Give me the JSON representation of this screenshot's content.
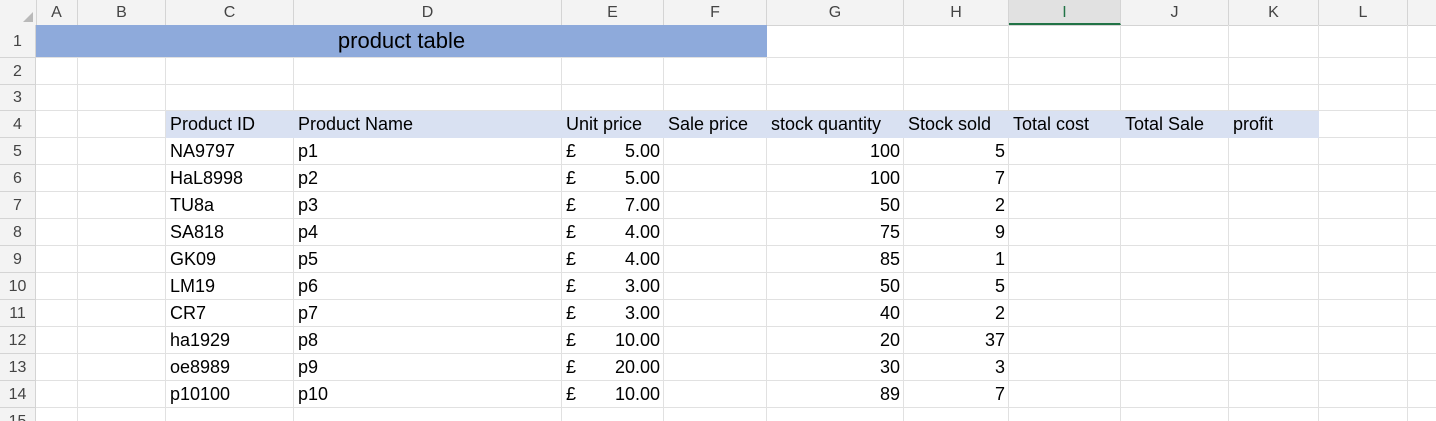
{
  "sheet": {
    "columns": [
      "A",
      "B",
      "C",
      "D",
      "E",
      "F",
      "G",
      "H",
      "I",
      "J",
      "K",
      "L"
    ],
    "selected_column": "I",
    "rows": [
      "1",
      "2",
      "3",
      "4",
      "5",
      "6",
      "7",
      "8",
      "9",
      "10",
      "11",
      "12",
      "13",
      "14",
      "15"
    ],
    "title": "product table",
    "headers": [
      "Product ID",
      "Product Name",
      "Unit price",
      "Sale price",
      "stock quantity",
      "Stock sold",
      "Total cost",
      "Total Sale",
      "profit"
    ],
    "currency_symbol": "£",
    "products": [
      {
        "id": "NA9797",
        "name": "p1",
        "unit_price": "5.00",
        "stock_quantity": "100",
        "stock_sold": "5"
      },
      {
        "id": "HaL8998",
        "name": "p2",
        "unit_price": "5.00",
        "stock_quantity": "100",
        "stock_sold": "7"
      },
      {
        "id": "TU8a",
        "name": "p3",
        "unit_price": "7.00",
        "stock_quantity": "50",
        "stock_sold": "2"
      },
      {
        "id": "SA818",
        "name": "p4",
        "unit_price": "4.00",
        "stock_quantity": "75",
        "stock_sold": "9"
      },
      {
        "id": "GK09",
        "name": "p5",
        "unit_price": "4.00",
        "stock_quantity": "85",
        "stock_sold": "1"
      },
      {
        "id": "LM19",
        "name": "p6",
        "unit_price": "3.00",
        "stock_quantity": "50",
        "stock_sold": "5"
      },
      {
        "id": "CR7",
        "name": "p7",
        "unit_price": "3.00",
        "stock_quantity": "40",
        "stock_sold": "2"
      },
      {
        "id": "ha1929",
        "name": "p8",
        "unit_price": "10.00",
        "stock_quantity": "20",
        "stock_sold": "37"
      },
      {
        "id": "oe8989",
        "name": "p9",
        "unit_price": "20.00",
        "stock_quantity": "30",
        "stock_sold": "3"
      },
      {
        "id": "p10100",
        "name": "p10",
        "unit_price": "10.00",
        "stock_quantity": "89",
        "stock_sold": "7"
      }
    ],
    "colors": {
      "title_fill": "#8eaadb",
      "header_fill": "#d9e1f2",
      "selected_header": "#217346"
    }
  }
}
